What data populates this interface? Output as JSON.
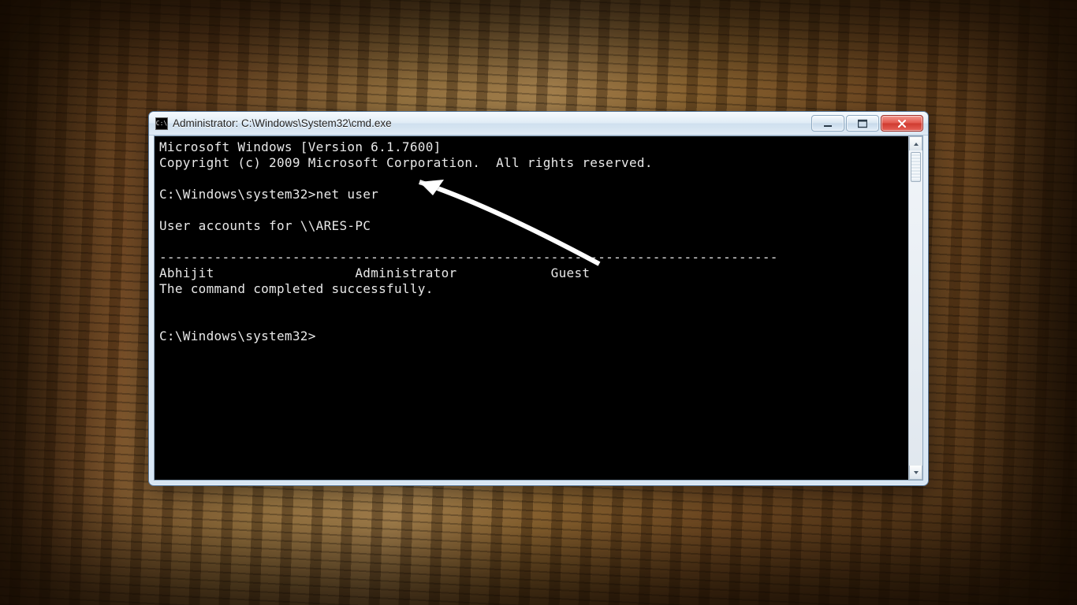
{
  "window": {
    "title": "Administrator: C:\\Windows\\System32\\cmd.exe",
    "icon_name": "cmd-icon"
  },
  "terminal": {
    "line_version": "Microsoft Windows [Version 6.1.7600]",
    "line_copyright": "Copyright (c) 2009 Microsoft Corporation.  All rights reserved.",
    "prompt1": "C:\\Windows\\system32>",
    "command1": "net user",
    "accounts_header": "User accounts for \\\\ARES-PC",
    "divider": "-------------------------------------------------------------------------------",
    "user1": "Abhijit",
    "user2": "Administrator",
    "user3": "Guest",
    "completed": "The command completed successfully.",
    "prompt2": "C:\\Windows\\system32>"
  }
}
